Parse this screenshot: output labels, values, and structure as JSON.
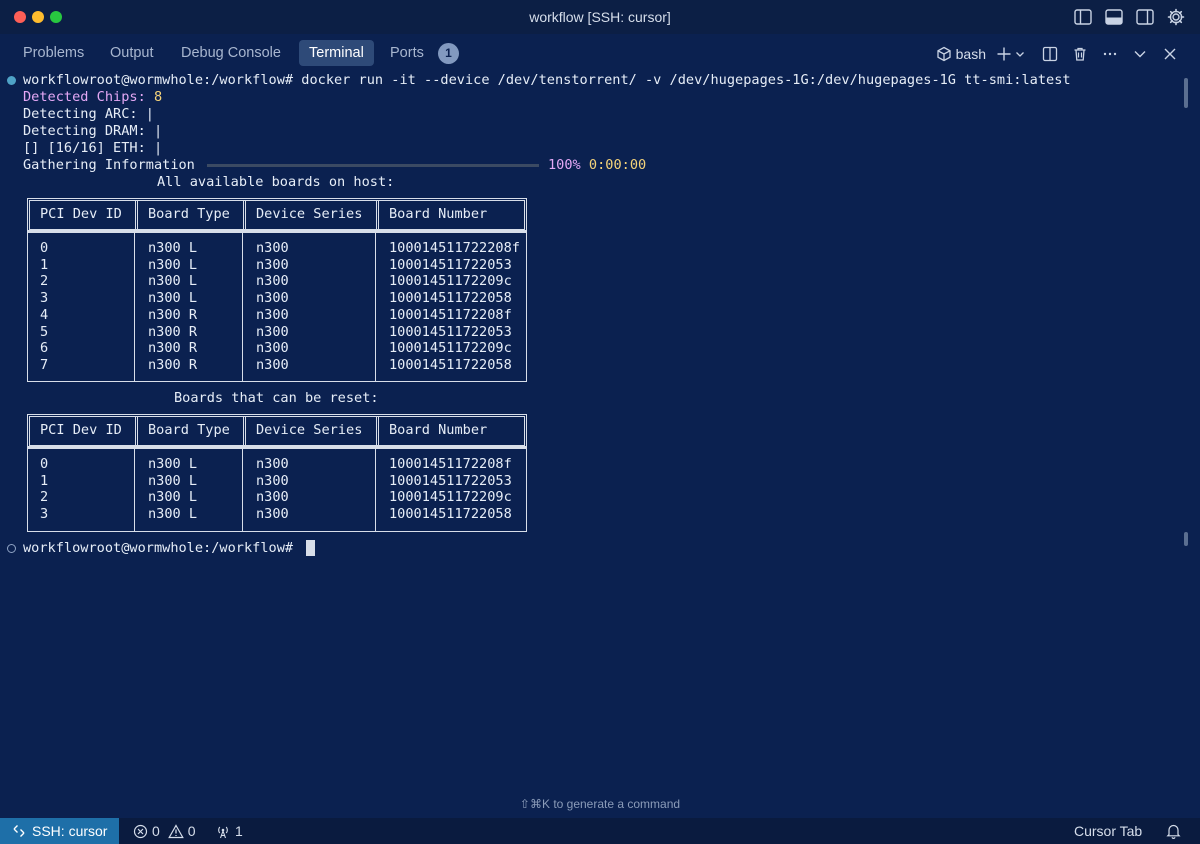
{
  "window": {
    "title": "workflow [SSH: cursor]"
  },
  "panel": {
    "tabs": [
      {
        "label": "Problems"
      },
      {
        "label": "Output"
      },
      {
        "label": "Debug Console"
      },
      {
        "label": "Terminal",
        "active": true
      },
      {
        "label": "Ports"
      }
    ],
    "ports_badge": "1",
    "shell_label": "bash"
  },
  "terminal": {
    "prompt": "workflowroot@wormwhole:/workflow#",
    "command": " docker run -it --device /dev/tenstorrent/ -v /dev/hugepages-1G:/dev/hugepages-1G tt-smi:latest",
    "detected_chips_label": "Detected Chips:",
    "detected_chips_value": " 8",
    "detecting_arc": "Detecting ARC: |",
    "detecting_dram": "Detecting DRAM: |",
    "eth_line": "[] [16/16] ETH: |",
    "gathering": "Gathering Information",
    "progress_pct": "100%",
    "progress_time": " 0:00:00",
    "progress_fraction": 1.0,
    "table1_caption": "All available boards on host:",
    "table2_caption": "Boards that can be reset:",
    "columns": [
      "PCI Dev ID",
      "Board Type",
      "Device Series",
      "Board Number"
    ],
    "all_boards": [
      [
        "0",
        "n300 L",
        "n300",
        "100014511722208f"
      ],
      [
        "1",
        "n300 L",
        "n300",
        "100014511722053"
      ],
      [
        "2",
        "n300 L",
        "n300",
        "10001451172209c"
      ],
      [
        "3",
        "n300 L",
        "n300",
        "100014511722058"
      ],
      [
        "4",
        "n300 R",
        "n300",
        "10001451172208f"
      ],
      [
        "5",
        "n300 R",
        "n300",
        "100014511722053"
      ],
      [
        "6",
        "n300 R",
        "n300",
        "10001451172209c"
      ],
      [
        "7",
        "n300 R",
        "n300",
        "100014511722058"
      ]
    ],
    "reset_boards": [
      [
        "0",
        "n300 L",
        "n300",
        "10001451172208f"
      ],
      [
        "1",
        "n300 L",
        "n300",
        "100014511722053"
      ],
      [
        "2",
        "n300 L",
        "n300",
        "10001451172209c"
      ],
      [
        "3",
        "n300 L",
        "n300",
        "100014511722058"
      ]
    ],
    "final_prompt": "workflowroot@wormwhole:/workflow#"
  },
  "hint": "⇧⌘K to generate a command",
  "statusbar": {
    "remote": "SSH: cursor",
    "errors": "0",
    "warnings": "0",
    "ports": "1",
    "cursor_tab": "Cursor Tab"
  },
  "colors": {
    "background": "#0b2150",
    "accent_remote": "#1e6fa8",
    "purple_text": "#e4a8f5",
    "yellow_text": "#f5d37a"
  }
}
